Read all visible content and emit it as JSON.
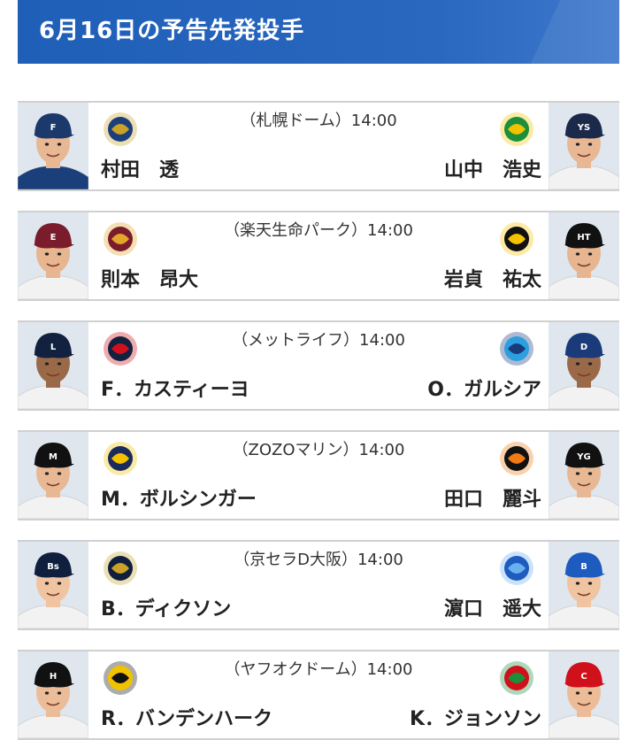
{
  "header": {
    "title": "6月16日の予告先発投手"
  },
  "games": [
    {
      "venue": "（札幌ドーム）14:00",
      "home_pitcher": "村田　透",
      "away_pitcher": "山中　浩史",
      "home_team_logo": "fighters-logo",
      "away_team_logo": "swallows-logo",
      "home_cap": "#1b3a6b",
      "away_cap": "#1b2a4a",
      "home_jersey": "#1a3f7a",
      "away_jersey": "#f2f2f2",
      "home_mark": "F",
      "away_mark": "YS"
    },
    {
      "venue": "（楽天生命パーク）14:00",
      "home_pitcher": "則本　昂大",
      "away_pitcher": "岩貞　祐太",
      "home_team_logo": "eagles-logo",
      "away_team_logo": "tigers-logo",
      "home_cap": "#7a1c2c",
      "away_cap": "#111111",
      "home_jersey": "#f2f2f2",
      "away_jersey": "#f2f2f2",
      "home_mark": "E",
      "away_mark": "HT"
    },
    {
      "venue": "（メットライフ）14:00",
      "home_pitcher": "F．カスティーヨ",
      "away_pitcher": "O．ガルシア",
      "home_team_logo": "lions-logo",
      "away_team_logo": "dragons-logo",
      "home_cap": "#12213f",
      "away_cap": "#1a3a7a",
      "home_jersey": "#f2f2f2",
      "away_jersey": "#f2f2f2",
      "home_mark": "L",
      "away_mark": "D"
    },
    {
      "venue": "（ZOZOマリン）14:00",
      "home_pitcher": "M．ボルシンガー",
      "away_pitcher": "田口　麗斗",
      "home_team_logo": "marines-logo",
      "away_team_logo": "giants-logo",
      "home_cap": "#111111",
      "away_cap": "#111111",
      "home_jersey": "#f2f2f2",
      "away_jersey": "#f2f2f2",
      "home_mark": "M",
      "away_mark": "YG"
    },
    {
      "venue": "（京セラD大阪）14:00",
      "home_pitcher": "B．ディクソン",
      "away_pitcher": "濵口　遥大",
      "home_team_logo": "buffaloes-logo",
      "away_team_logo": "baystars-logo",
      "home_cap": "#0f1f3d",
      "away_cap": "#1e5bbf",
      "home_jersey": "#f2f2f2",
      "away_jersey": "#f2f2f2",
      "home_mark": "Bs",
      "away_mark": "B"
    },
    {
      "venue": "（ヤフオクドーム）14:00",
      "home_pitcher": "R．バンデンハーク",
      "away_pitcher": "K．ジョンソン",
      "home_team_logo": "hawks-logo",
      "away_team_logo": "carp-logo",
      "home_cap": "#111111",
      "away_cap": "#d0111b",
      "home_jersey": "#f2f2f2",
      "away_jersey": "#f2f2f2",
      "home_mark": "H",
      "away_mark": "C"
    }
  ]
}
